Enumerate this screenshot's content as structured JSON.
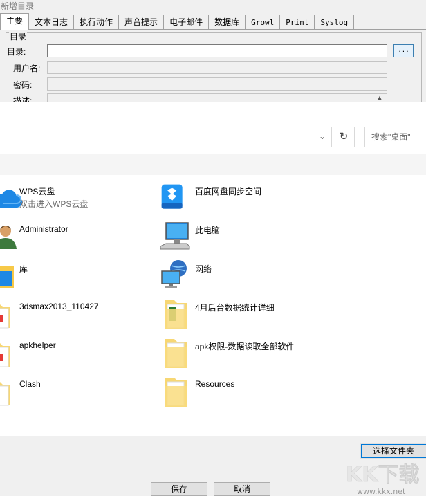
{
  "window": {
    "title": "新增目录"
  },
  "tabs": [
    {
      "label": "主要",
      "active": true
    },
    {
      "label": "文本日志"
    },
    {
      "label": "执行动作"
    },
    {
      "label": "声音提示"
    },
    {
      "label": "电子邮件"
    },
    {
      "label": "数据库"
    },
    {
      "label": "Growl"
    },
    {
      "label": "Print"
    },
    {
      "label": "Syslog"
    }
  ],
  "form": {
    "group_label": "目录",
    "directory_label": "目录:",
    "username_label": "用户名:",
    "password_label": "密码:",
    "description_label": "描述:",
    "browse_label": "..."
  },
  "picker": {
    "search_placeholder": "搜索\"桌面\"",
    "items": [
      {
        "name": "WPS云盘",
        "sub": "双击进入WPS云盘",
        "icon": "cloud-icon"
      },
      {
        "name": "百度网盘同步空间",
        "icon": "baidu-netdisk-icon"
      },
      {
        "name": "Administrator",
        "icon": "user-icon"
      },
      {
        "name": "此电脑",
        "icon": "computer-icon"
      },
      {
        "name": "库",
        "icon": "library-icon"
      },
      {
        "name": "网络",
        "icon": "network-icon"
      },
      {
        "name": "3dsmax2013_110427",
        "icon": "folder-icon"
      },
      {
        "name": "4月后台数据统计详细",
        "icon": "folder-icon"
      },
      {
        "name": "apkhelper",
        "icon": "folder-icon"
      },
      {
        "name": "apk权限-数据读取全部软件",
        "icon": "folder-icon"
      },
      {
        "name": "Clash",
        "icon": "folder-icon"
      },
      {
        "name": "Resources",
        "icon": "folder-icon"
      }
    ],
    "select_folder_label": "选择文件夹"
  },
  "buttons": {
    "save": "保存",
    "cancel": "取消"
  },
  "watermark": {
    "logo": "KK下载",
    "url": "www.kkx.net"
  },
  "colors": {
    "accent": "#0078d7",
    "folder": "#f7d774",
    "cloud": "#1e88e5",
    "baidu": "#2196f3"
  }
}
